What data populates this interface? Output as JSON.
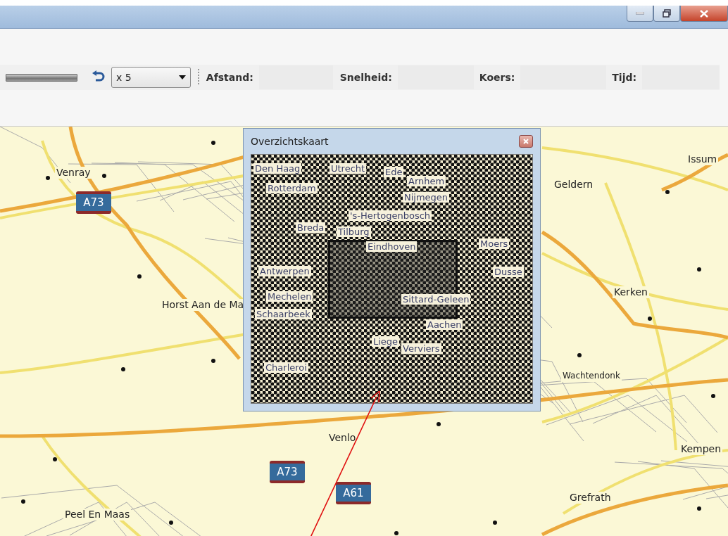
{
  "toolbar": {
    "speed_multiplier": "x 5",
    "fields": [
      {
        "label": "Afstand:"
      },
      {
        "label": "Snelheid:"
      },
      {
        "label": "Koers:"
      },
      {
        "label": "Tijd:"
      }
    ]
  },
  "map": {
    "places": [
      "Venray",
      "Horst Aan de Ma",
      "Peel En Maas",
      "Venlo",
      "Geldern",
      "Issum",
      "Kerken",
      "Wachtendonk",
      "Kempen",
      "Grefrath"
    ],
    "road_shields": [
      "A73",
      "A73",
      "A61"
    ]
  },
  "overview": {
    "title": "Overzichtskaart",
    "places": [
      "Den Haag",
      "Utrecht",
      "Ede",
      "Rotterdam",
      "Arnhem",
      "Nijmegen",
      "'s-Hertogenbosch",
      "Breda",
      "Tilburg",
      "Eindhoven",
      "Moers",
      "Antwerpen",
      "Dusse",
      "Mechelen",
      "Schaarbeek",
      "Sittard-Geleen",
      "Aachen",
      "Liege",
      "Verviers",
      "Charleroi"
    ]
  }
}
